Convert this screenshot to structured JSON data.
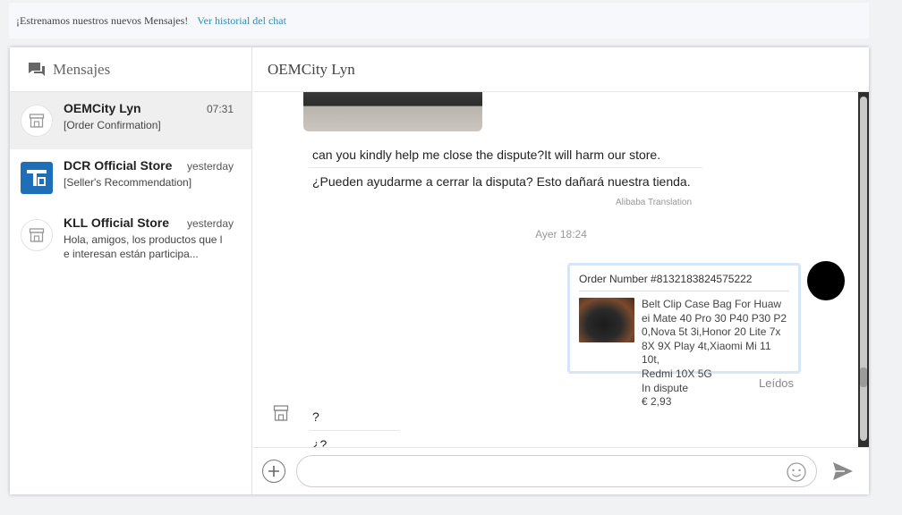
{
  "notice": {
    "text": "¡Estrenamos nuestros nuevos Mensajes!",
    "link": "Ver historial del chat"
  },
  "sidebar": {
    "title": "Mensajes",
    "conversations": [
      {
        "name": "OEMCity Lyn",
        "time": "07:31",
        "preview": "[Order Confirmation]",
        "avatar": "store-icon",
        "active": true
      },
      {
        "name": "DCR Official Store",
        "time": "yesterday",
        "preview": "[Seller's Recommendation]",
        "avatar": "dcr-logo"
      },
      {
        "name": "KLL Official Store",
        "time": "yesterday",
        "preview_line1": "Hola, amigos, los productos que l",
        "preview_line2": "e interesan están participa...",
        "avatar": "store-icon"
      }
    ]
  },
  "chat": {
    "title": "OEMCity Lyn",
    "message_en": "can you kindly help me close the dispute?It will harm our store.",
    "message_es": "¿Pueden ayudarme a cerrar la disputa? Esto dañará nuestra tienda.",
    "translation_note": "Alibaba Translation",
    "timestamp": "Ayer 18:24",
    "order_card": {
      "number": "Order Number #8132183824575222",
      "desc_lines": [
        "Belt Clip Case Bag For Huaw",
        "ei Mate 40 Pro 30 P40 P30 P2",
        "0,Nova 5t 3i,Honor 20 Lite 7x",
        "8X 9X Play 4t,Xiaomi Mi 11 10t,",
        "Redmi 10X 5G"
      ],
      "status": "In dispute",
      "price": "€ 2,93"
    },
    "read_status": "Leídos",
    "reply_1": "?",
    "reply_2": "¿?"
  },
  "composer": {
    "placeholder": ""
  },
  "colors": {
    "link": "#2a8fb7",
    "active_conv": "#efefef",
    "card_border": "#d7e6f5"
  }
}
